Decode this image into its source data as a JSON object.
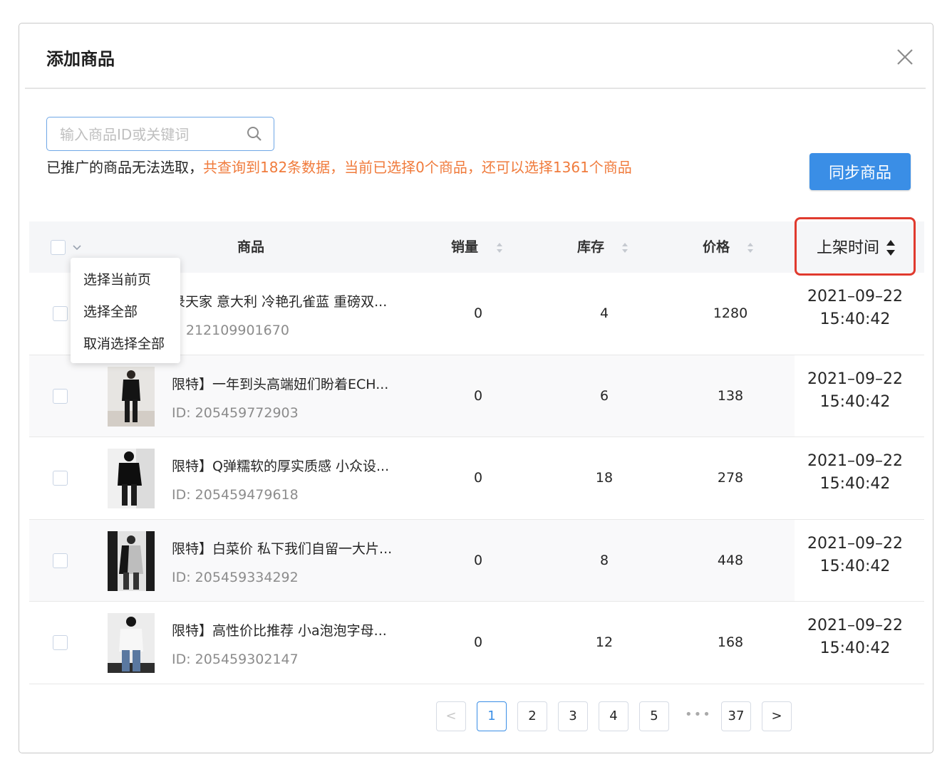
{
  "dialog": {
    "title": "添加商品",
    "close_icon": "close-icon"
  },
  "search": {
    "placeholder": "输入商品ID或关键词",
    "value": "",
    "icon": "search-icon"
  },
  "info": {
    "prefix": "已推广的商品无法选取，",
    "highlight": "共查询到182条数据，当前已选择0个商品，还可以选择1361个商品"
  },
  "sync_button_label": "同步商品",
  "table": {
    "columns": {
      "product": "商品",
      "sales": "销量",
      "stock": "库存",
      "price": "价格",
      "listed_time": "上架时间"
    },
    "select_menu": [
      "选择当前页",
      "选择全部",
      "取消选择全部"
    ],
    "rows": [
      {
        "name": "绿天家 意大利 冷艳孔雀蓝 重磅双...",
        "id": "ID: 212109901670",
        "sales": "0",
        "stock": "4",
        "price": "1280",
        "date": "2021–09–22",
        "time": "15:40:42",
        "name_visible": "录天家 意大利 冷艳孔雀蓝 重磅双...",
        "id_visible": "): 212109901670"
      },
      {
        "name": "限特】一年到头高端妞们盼着ECH...",
        "id": "ID: 205459772903",
        "sales": "0",
        "stock": "6",
        "price": "138",
        "date": "2021–09–22",
        "time": "15:40:42"
      },
      {
        "name": "限特】Q弹糯软的厚实质感 小众设...",
        "id": "ID: 205459479618",
        "sales": "0",
        "stock": "18",
        "price": "278",
        "date": "2021–09–22",
        "time": "15:40:42"
      },
      {
        "name": "限特】白菜价 私下我们自留一大片...",
        "id": "ID: 205459334292",
        "sales": "0",
        "stock": "8",
        "price": "448",
        "date": "2021–09–22",
        "time": "15:40:42"
      },
      {
        "name": "限特】高性价比推荐 小a泡泡字母...",
        "id": "ID: 205459302147",
        "sales": "0",
        "stock": "12",
        "price": "168",
        "date": "2021–09–22",
        "time": "15:40:42"
      }
    ]
  },
  "pagination": {
    "prev": "<",
    "pages": [
      "1",
      "2",
      "3",
      "4",
      "5"
    ],
    "ellipsis": "•••",
    "last": "37",
    "next": ">",
    "current": "1"
  },
  "colors": {
    "accent": "#3a8ee6",
    "warning_text": "#f07b3c",
    "highlight_box": "#e03a2e"
  }
}
